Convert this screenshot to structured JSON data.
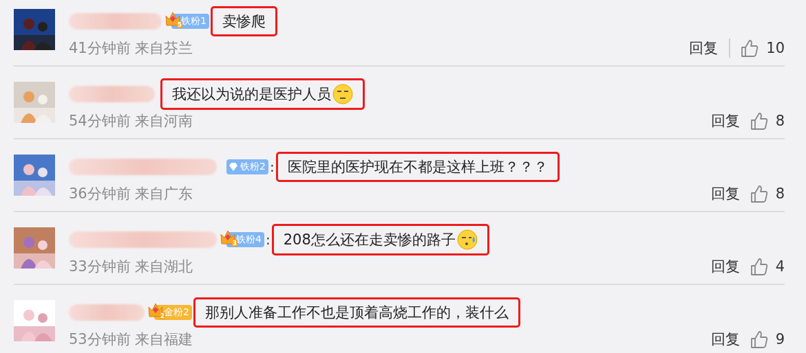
{
  "comments": [
    {
      "badge": {
        "kind": "crown",
        "crown_digit": "5",
        "label": "铁粉1",
        "color": "#7fb5f5"
      },
      "text": "卖惨爬",
      "highlighted": true,
      "time": "41分钟前",
      "location": "来自芬兰",
      "reply": "回复",
      "reply_divider": true,
      "likes": "10"
    },
    {
      "text": "我还以为说的是医护人员",
      "emoji": {
        "kind": "squint"
      },
      "highlighted": true,
      "time": "54分钟前",
      "location": "来自河南",
      "reply": "回复",
      "reply_divider": false,
      "likes": "8"
    },
    {
      "badge": {
        "kind": "diamond",
        "label": "铁粉2",
        "color": "#7fb5f5"
      },
      "colon": ":",
      "text": "医院里的医护现在不都是这样上班？？？",
      "highlighted": true,
      "time": "36分钟前",
      "location": "来自广东",
      "reply": "回复",
      "reply_divider": false,
      "likes": "8"
    },
    {
      "badge": {
        "kind": "crown",
        "crown_digit": "3",
        "label": "铁粉4",
        "color": "#7fb5f5"
      },
      "colon": ":",
      "text": "208怎么还在走卖惨的路子",
      "emoji": {
        "kind": "sweat"
      },
      "highlighted": true,
      "time": "33分钟前",
      "location": "来自湖北",
      "reply": "回复",
      "reply_divider": false,
      "likes": "4"
    },
    {
      "badge": {
        "kind": "crown",
        "crown_digit": "2",
        "label": "金粉2",
        "color": "#f7b733"
      },
      "text": "那别人准备工作不也是顶着高烧工作的，装什么",
      "highlighted": true,
      "time": "53分钟前",
      "location": "来自福建",
      "reply": "回复",
      "reply_divider": false,
      "likes": "9"
    }
  ]
}
